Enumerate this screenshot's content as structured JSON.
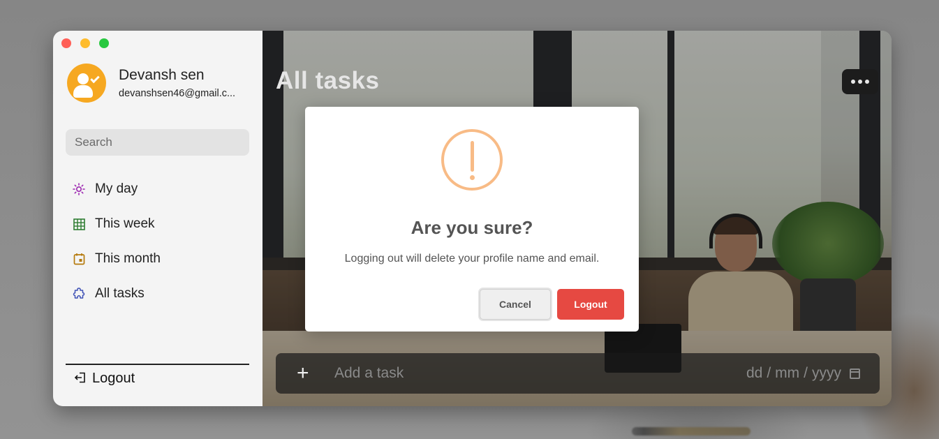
{
  "window": {
    "traffic_lights": [
      "close",
      "minimize",
      "maximize"
    ]
  },
  "profile": {
    "name": "Devansh sen",
    "email": "devanshsen46@gmail.c..."
  },
  "search": {
    "placeholder": "Search"
  },
  "nav": {
    "items": [
      {
        "label": "My day",
        "icon": "sun-icon",
        "color": "#9c27b0"
      },
      {
        "label": "This week",
        "icon": "grid-icon",
        "color": "#2e7d32"
      },
      {
        "label": "This month",
        "icon": "calendar-icon",
        "color": "#b57a0c"
      },
      {
        "label": "All tasks",
        "icon": "puzzle-icon",
        "color": "#3f51b5"
      }
    ]
  },
  "sidebar_footer": {
    "logout_label": "Logout",
    "icon": "logout-icon"
  },
  "main": {
    "title": "All tasks",
    "add_task_placeholder": "Add a task",
    "plus_label": "+",
    "date": {
      "dd": "dd",
      "mm": "mm",
      "yyyy": "yyyy",
      "sep": "/"
    }
  },
  "modal": {
    "icon": "warning-icon",
    "title": "Are you sure?",
    "text": "Logging out will delete your profile name and email.",
    "cancel_label": "Cancel",
    "confirm_label": "Logout",
    "confirm_color": "#e64942",
    "warning_color": "#f8bb86"
  }
}
